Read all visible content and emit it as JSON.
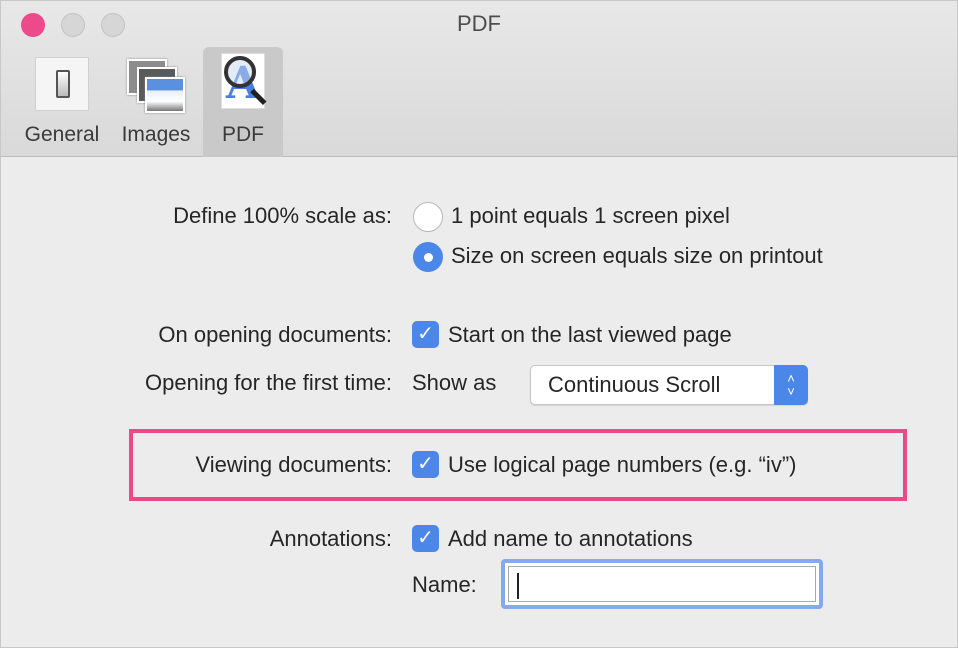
{
  "window": {
    "title": "PDF"
  },
  "toolbar": {
    "tabs": [
      {
        "label": "General",
        "icon": "light-switch-icon",
        "selected": false
      },
      {
        "label": "Images",
        "icon": "photo-stack-icon",
        "selected": false
      },
      {
        "label": "PDF",
        "icon": "magnifier-letter-a-icon",
        "selected": true
      }
    ]
  },
  "settings": {
    "scale": {
      "label": "Define 100% scale as:",
      "options": [
        {
          "label": "1 point equals 1 screen pixel",
          "selected": false
        },
        {
          "label": "Size on screen equals size on printout",
          "selected": true
        }
      ]
    },
    "opening": {
      "label": "On opening documents:",
      "checkbox_label": "Start on the last viewed page",
      "checked": true
    },
    "first_time": {
      "label": "Opening for the first time:",
      "prefix": "Show as",
      "selected_value": "Continuous Scroll"
    },
    "viewing": {
      "label": "Viewing documents:",
      "checkbox_label": "Use logical page numbers (e.g. “iv”)",
      "checked": true,
      "highlighted": true
    },
    "annotations": {
      "label": "Annotations:",
      "checkbox_label": "Add name to annotations",
      "checked": true,
      "name_label": "Name:",
      "name_value": ""
    }
  },
  "colors": {
    "accent": "#4a87e8",
    "highlight_border": "#e84a8a",
    "close_button": "#ec4a8a"
  },
  "icons": {
    "check": "✓",
    "up": "˄",
    "down": "˅"
  }
}
